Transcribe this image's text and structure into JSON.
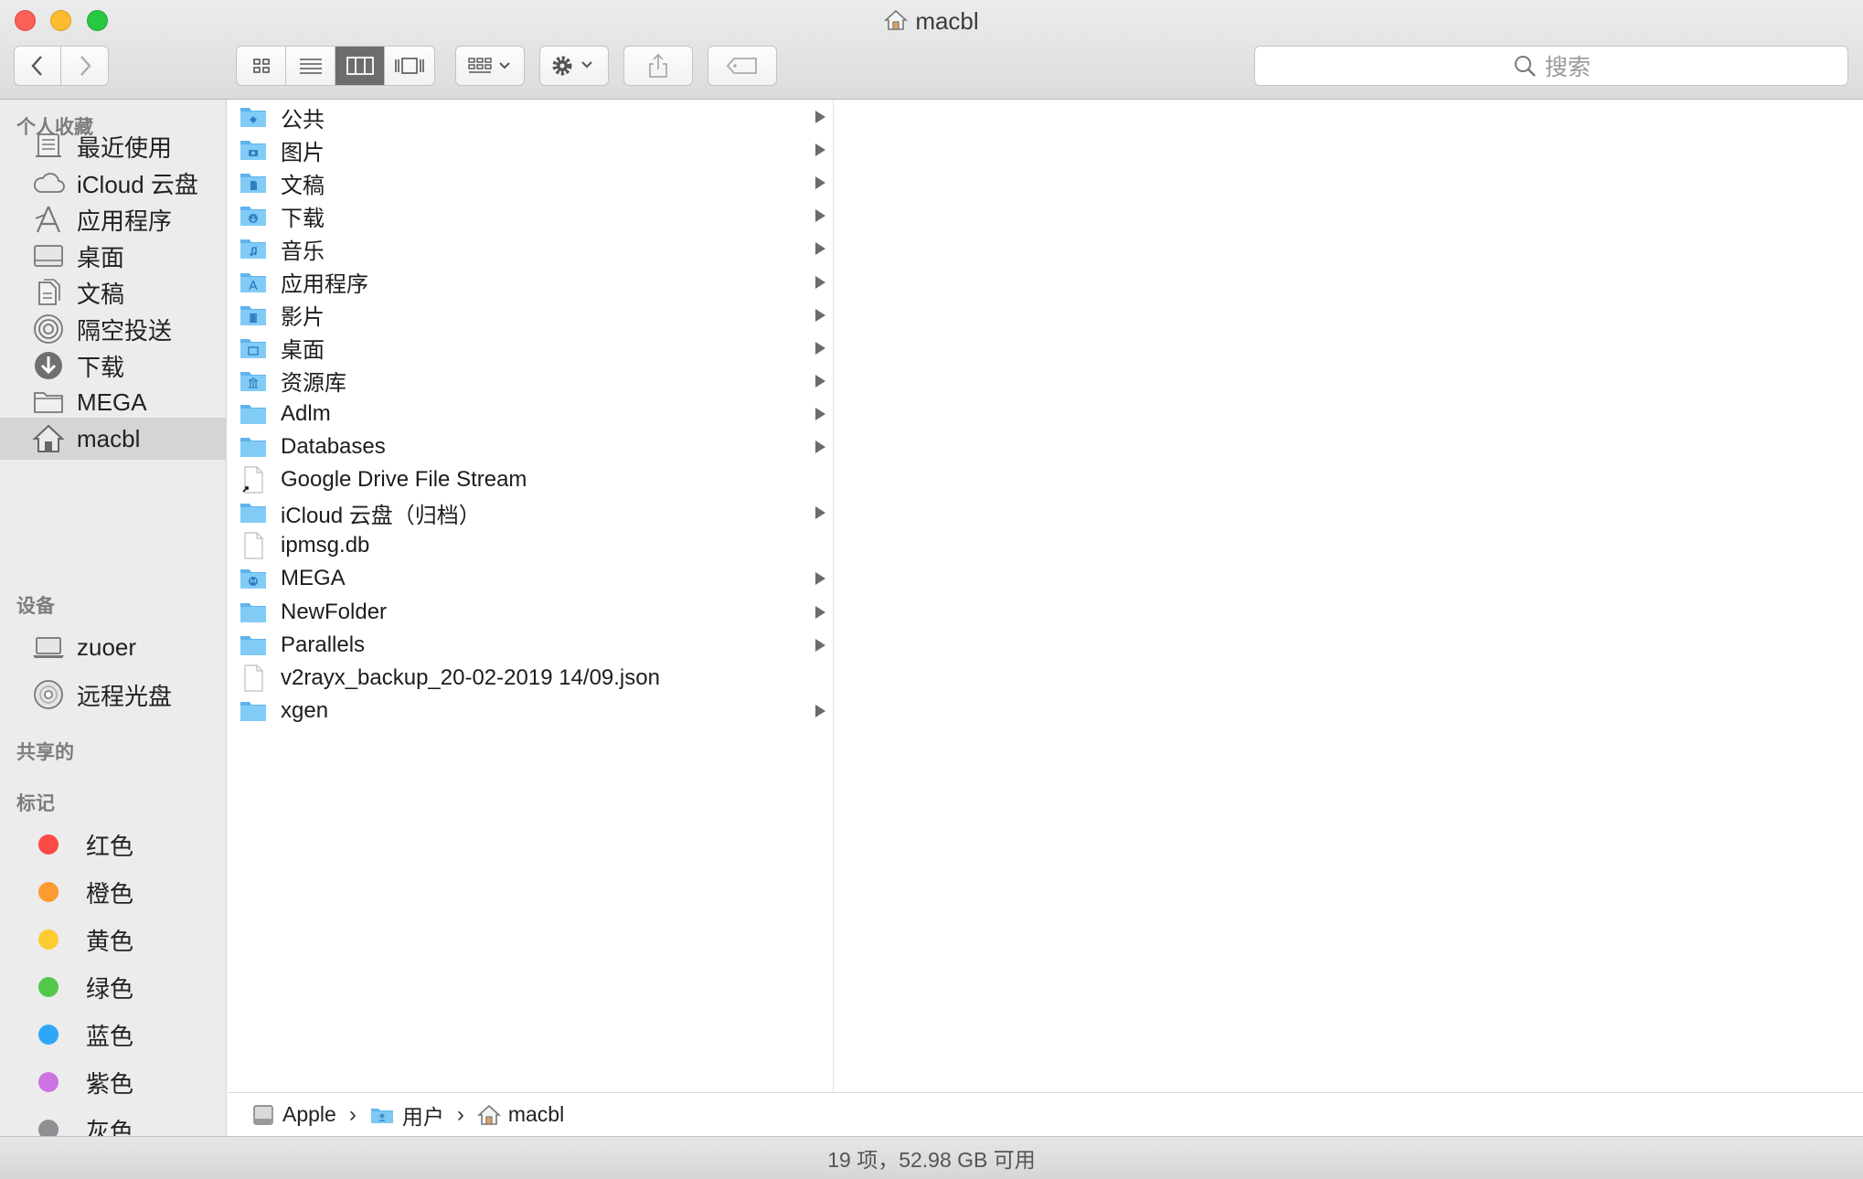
{
  "window": {
    "title": "macbl"
  },
  "toolbar": {
    "search_placeholder": "搜索"
  },
  "sidebar": {
    "favorites_header": "个人收藏",
    "favorites": [
      {
        "label": "最近使用",
        "icon": "recents-icon"
      },
      {
        "label": "iCloud 云盘",
        "icon": "cloud-icon"
      },
      {
        "label": "应用程序",
        "icon": "applications-icon"
      },
      {
        "label": "桌面",
        "icon": "desktop-icon"
      },
      {
        "label": "文稿",
        "icon": "documents-icon"
      },
      {
        "label": "隔空投送",
        "icon": "airdrop-icon"
      },
      {
        "label": "下载",
        "icon": "downloads-icon"
      },
      {
        "label": "MEGA",
        "icon": "folder-icon"
      },
      {
        "label": "macbl",
        "icon": "home-icon"
      }
    ],
    "devices_header": "设备",
    "devices": [
      {
        "label": "zuoer",
        "icon": "laptop-icon"
      },
      {
        "label": "远程光盘",
        "icon": "disc-icon"
      }
    ],
    "shared_header": "共享的",
    "tags_header": "标记",
    "tags": [
      {
        "label": "红色",
        "color": "#fc4a46"
      },
      {
        "label": "橙色",
        "color": "#fd9a30"
      },
      {
        "label": "黄色",
        "color": "#fdcc32"
      },
      {
        "label": "绿色",
        "color": "#52c84a"
      },
      {
        "label": "蓝色",
        "color": "#2fa7f8"
      },
      {
        "label": "紫色",
        "color": "#cc73e1"
      },
      {
        "label": "灰色",
        "color": "#8e8e93"
      }
    ]
  },
  "files": [
    {
      "name": "公共",
      "kind": "folder",
      "badge": "public-icon",
      "arrow": true
    },
    {
      "name": "图片",
      "kind": "folder",
      "badge": "camera-icon",
      "arrow": true
    },
    {
      "name": "文稿",
      "kind": "folder",
      "badge": "document-icon",
      "arrow": true
    },
    {
      "name": "下载",
      "kind": "folder",
      "badge": "download-icon",
      "arrow": true
    },
    {
      "name": "音乐",
      "kind": "folder",
      "badge": "music-icon",
      "arrow": true
    },
    {
      "name": "应用程序",
      "kind": "folder",
      "badge": "applications-icon",
      "arrow": true
    },
    {
      "name": "影片",
      "kind": "folder",
      "badge": "film-icon",
      "arrow": true
    },
    {
      "name": "桌面",
      "kind": "folder",
      "badge": "desktop-icon",
      "arrow": true
    },
    {
      "name": "资源库",
      "kind": "folder",
      "badge": "library-icon",
      "arrow": true
    },
    {
      "name": "Adlm",
      "kind": "folder",
      "badge": "",
      "arrow": true
    },
    {
      "name": "Databases",
      "kind": "folder",
      "badge": "",
      "arrow": true
    },
    {
      "name": "Google Drive File Stream",
      "kind": "alias",
      "badge": "",
      "arrow": false
    },
    {
      "name": "iCloud 云盘（归档）",
      "kind": "folder",
      "badge": "",
      "arrow": true
    },
    {
      "name": "ipmsg.db",
      "kind": "file",
      "badge": "",
      "arrow": false
    },
    {
      "name": "MEGA",
      "kind": "folder",
      "badge": "mega-icon",
      "arrow": true
    },
    {
      "name": "NewFolder",
      "kind": "folder",
      "badge": "",
      "arrow": true
    },
    {
      "name": "Parallels",
      "kind": "folder",
      "badge": "",
      "arrow": true
    },
    {
      "name": "v2rayx_backup_20-02-2019 14/09.json",
      "kind": "file",
      "badge": "",
      "arrow": false
    },
    {
      "name": "xgen",
      "kind": "folder",
      "badge": "",
      "arrow": true
    }
  ],
  "pathbar": [
    "Apple",
    "用户",
    "macbl"
  ],
  "status": {
    "text": "19 项，52.98 GB 可用"
  }
}
